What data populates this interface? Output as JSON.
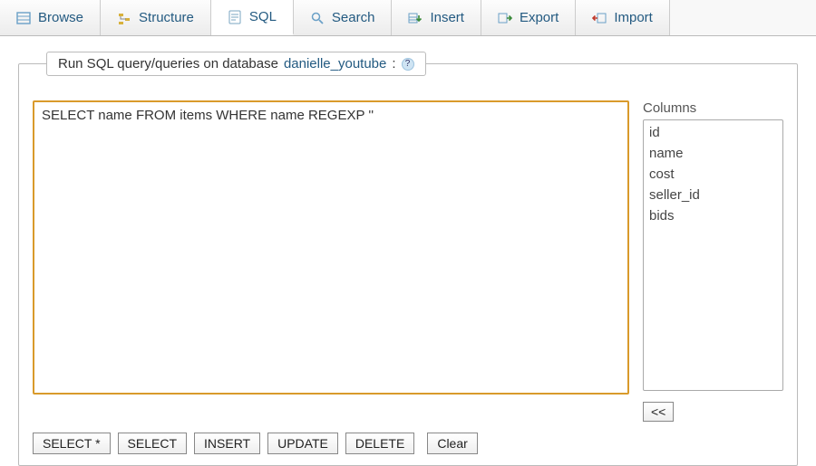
{
  "tabs": {
    "browse": {
      "label": "Browse"
    },
    "structure": {
      "label": "Structure"
    },
    "sql": {
      "label": "SQL"
    },
    "search": {
      "label": "Search"
    },
    "insert": {
      "label": "Insert"
    },
    "export": {
      "label": "Export"
    },
    "import": {
      "label": "Import"
    }
  },
  "legend": {
    "prefix": "Run SQL query/queries on database ",
    "dbname": "danielle_youtube",
    "suffix": ": "
  },
  "sql_query": "SELECT name FROM items WHERE name REGEXP ''",
  "columns_title": "Columns",
  "columns": [
    "id",
    "name",
    "cost",
    "seller_id",
    "bids"
  ],
  "buttons": {
    "select_star": "SELECT *",
    "select": "SELECT",
    "insert": "INSERT",
    "update": "UPDATE",
    "delete": "DELETE",
    "clear": "Clear",
    "cols_insert": "<<"
  }
}
